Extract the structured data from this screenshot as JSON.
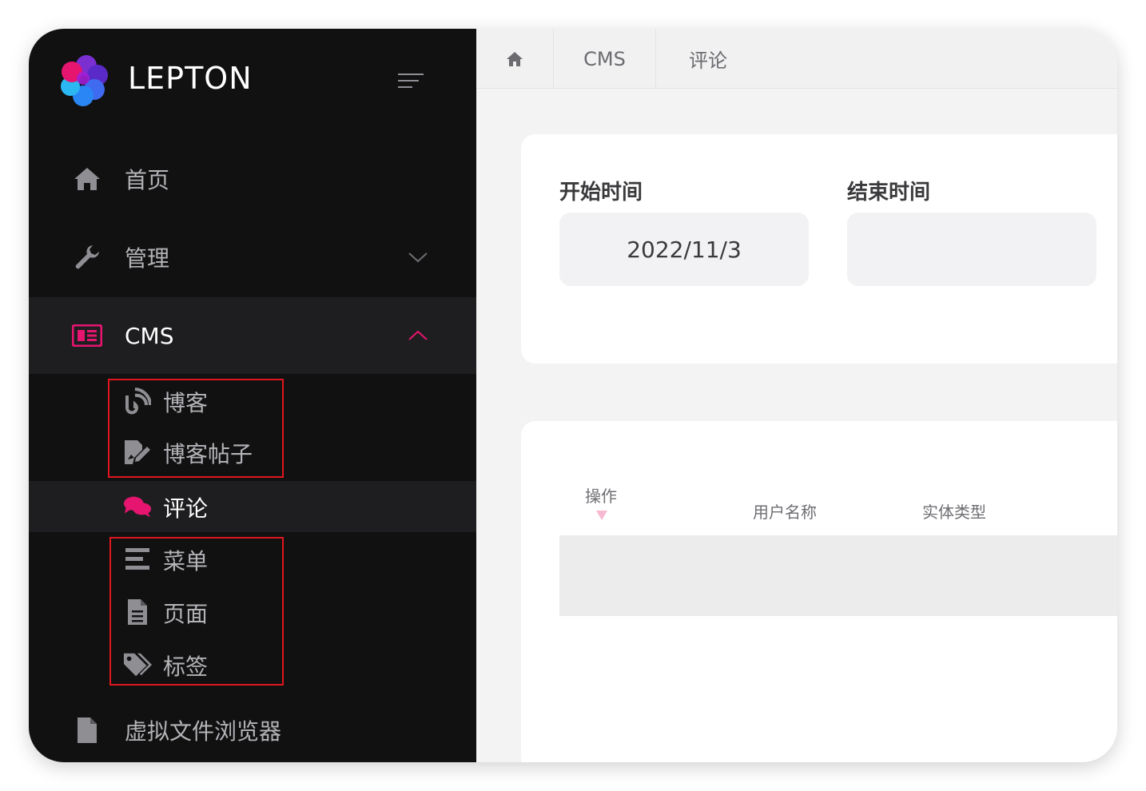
{
  "sidebar": {
    "brand": "LEPTON",
    "items": {
      "home": "首页",
      "admin": "管理",
      "cms": "CMS",
      "file_browser": "虚拟文件浏览器"
    },
    "cms_children": {
      "blog": "博客",
      "blog_posts": "博客帖子",
      "comments": "评论",
      "menus": "菜单",
      "pages": "页面",
      "tags": "标签"
    }
  },
  "breadcrumb": {
    "level1": "CMS",
    "level2": "评论"
  },
  "filter": {
    "start_label": "开始时间",
    "start_value": "2022/11/3",
    "end_label": "结束时间",
    "end_value": ""
  },
  "table": {
    "columns": {
      "actions": "操作",
      "user_name": "用户名称",
      "entity_type": "实体类型"
    }
  },
  "colors": {
    "accent": "#e6156f",
    "sidebar_bg": "#111112",
    "highlight_box": "#e0161e"
  }
}
